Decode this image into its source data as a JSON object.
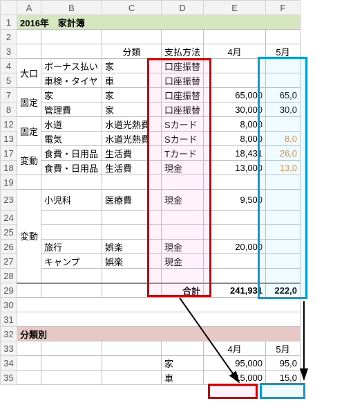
{
  "columns": [
    "A",
    "B",
    "C",
    "D",
    "E",
    "F"
  ],
  "row_numbers": [
    "1",
    "2",
    "3",
    "4",
    "5",
    "7",
    "8",
    "12",
    "13",
    "17",
    "18",
    "19",
    "23",
    "24",
    "25",
    "26",
    "27",
    "28",
    "29",
    "30",
    "31",
    "32",
    "33",
    "34",
    "35"
  ],
  "title": "2016年　家計簿",
  "header": {
    "cat": "分類",
    "method": "支払方法",
    "apr": "4月",
    "may": "5月"
  },
  "section1": {
    "label": "大口",
    "r1": {
      "item": "ボーナス払い",
      "cat": "家",
      "method": "口座振替"
    },
    "r2": {
      "item": "車検・タイヤ",
      "cat": "車",
      "method": "口座振替"
    }
  },
  "section2": {
    "label": "固定",
    "r1": {
      "item": "家",
      "cat": "家",
      "method": "口座振替",
      "apr": "65,000",
      "may": "65,0"
    },
    "r2": {
      "item": "管理費",
      "cat": "家",
      "method": "口座振替",
      "apr": "30,000",
      "may": "30,0"
    }
  },
  "section3": {
    "label": "固定",
    "r1": {
      "item": "水道",
      "cat": "水道光熱費",
      "method": "Sカード",
      "apr": "8,000"
    },
    "r2": {
      "item": "電気",
      "cat": "水道光熱費",
      "method": "Sカード",
      "apr": "8,000",
      "may": "8,0"
    }
  },
  "section4": {
    "label": "変動",
    "r1": {
      "item": "食費・日用品",
      "cat": "生活費",
      "method": "Tカード",
      "apr": "18,431",
      "may": "26,0"
    },
    "r2": {
      "item": "食費・日用品",
      "cat": "生活費",
      "method": "現金",
      "apr": "13,000",
      "may": "13,0"
    }
  },
  "section5": {
    "label": "変動",
    "r1": {
      "item": "小児科",
      "cat": "医療費",
      "method": "現金",
      "apr": "9,500"
    },
    "r2": {
      "item": "",
      "cat": "",
      "method": ""
    },
    "r3": {
      "item": "",
      "cat": "",
      "method": ""
    },
    "r4": {
      "item": "旅行",
      "cat": "娯楽",
      "method": "現金",
      "apr": "20,000"
    },
    "r5": {
      "item": "キャンプ",
      "cat": "娯楽",
      "method": "現金"
    },
    "r6": {}
  },
  "total": {
    "label": "合計",
    "apr": "241,931",
    "may": "222,0"
  },
  "cat_section": {
    "title": "分類別",
    "apr": "4月",
    "may": "5月",
    "r1": {
      "label": "家",
      "apr": "95,000",
      "may": "95,0"
    },
    "r2": {
      "label": "車",
      "apr": "15,000",
      "may": "15,0"
    }
  }
}
